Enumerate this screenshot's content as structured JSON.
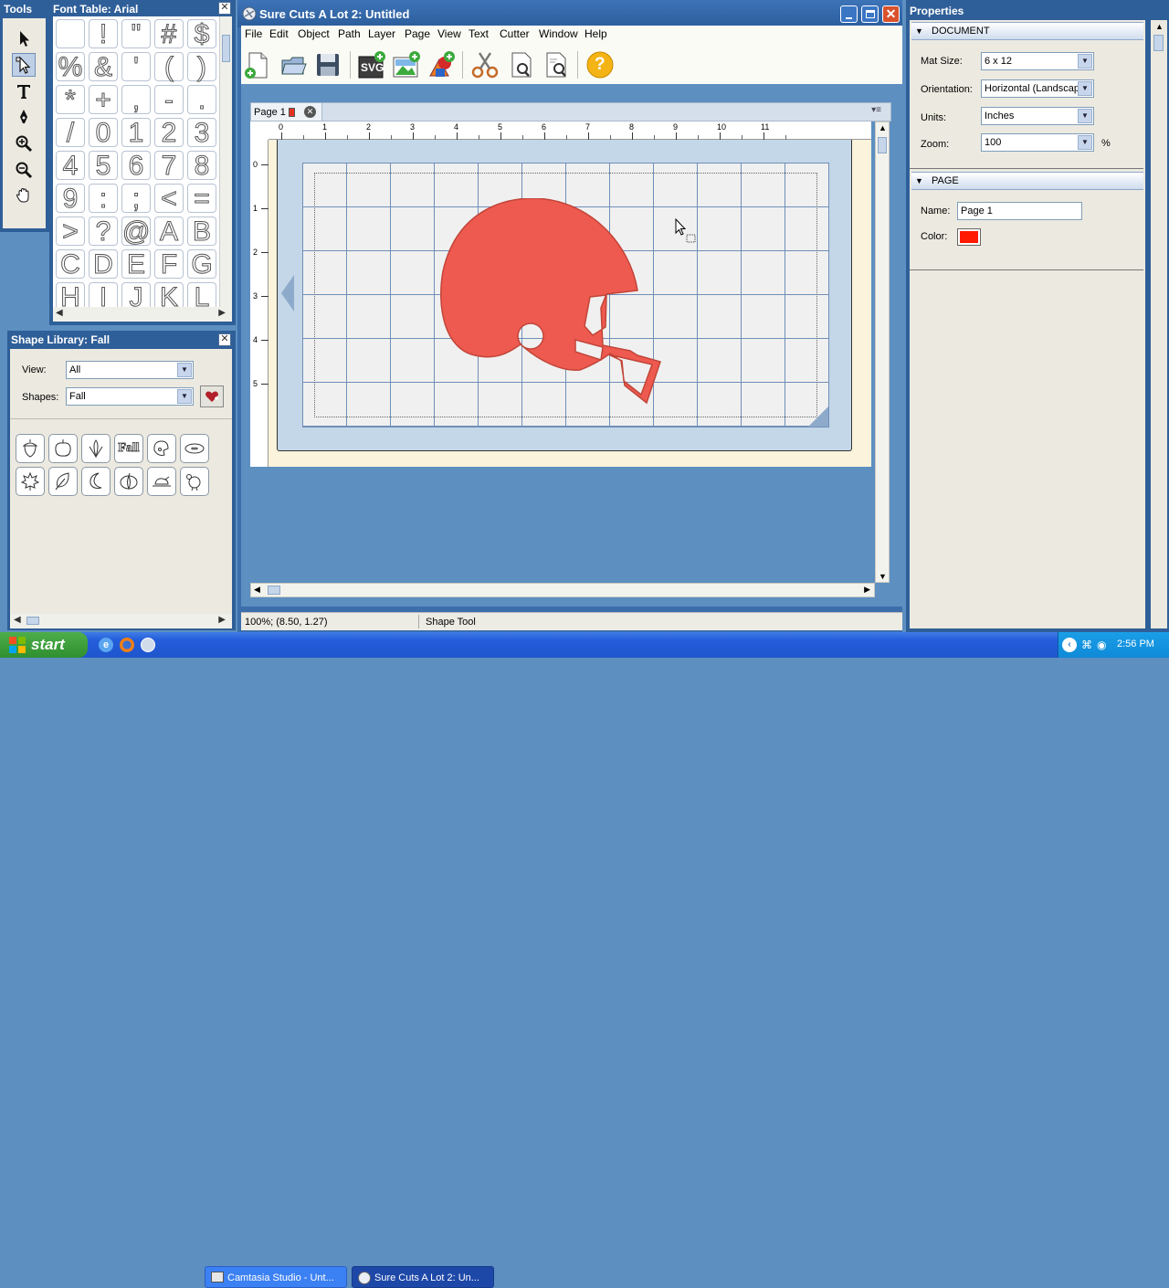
{
  "tools_panel": {
    "title": "Tools"
  },
  "font_table": {
    "title": "Font Table: Arial",
    "glyphs": [
      "",
      "!",
      "\"",
      "#",
      "$",
      "%",
      "&",
      "'",
      "(",
      ")",
      "*",
      "+",
      ",",
      "-",
      ".",
      "/",
      "0",
      "1",
      "2",
      "3",
      "4",
      "5",
      "6",
      "7",
      "8",
      "9",
      ":",
      ";",
      "<",
      "=",
      ">",
      "?",
      "@",
      "A",
      "B",
      "C",
      "D",
      "E",
      "F",
      "G",
      "H",
      "I",
      "J",
      "K",
      "L"
    ]
  },
  "shape_library": {
    "title": "Shape Library: Fall",
    "view_label": "View:",
    "view_value": "All",
    "shapes_label": "Shapes:",
    "shapes_value": "Fall",
    "thumb_text": "Fall"
  },
  "app": {
    "title": "Sure Cuts A Lot 2: Untitled",
    "menu": [
      "File",
      "Edit",
      "Object",
      "Path",
      "Layer",
      "Page",
      "View",
      "Text",
      "Cutter",
      "Window",
      "Help"
    ],
    "tab_label": "Page 1",
    "ruler_x": [
      "0",
      "1",
      "2",
      "3",
      "4",
      "5",
      "6",
      "7",
      "8",
      "9",
      "10",
      "11"
    ],
    "ruler_y": [
      "0",
      "1",
      "2",
      "3",
      "4",
      "5"
    ],
    "status_zoom": "100%; (8.50, 1.27)",
    "status_tool": "Shape Tool",
    "helmet_color": "#ee5a50",
    "svg_badge": "SVG",
    "help_glyph": "?"
  },
  "properties": {
    "title": "Properties",
    "document_header": "DOCUMENT",
    "mat_size_label": "Mat Size:",
    "mat_size_value": "6 x 12",
    "orientation_label": "Orientation:",
    "orientation_value": "Horizontal (Landscap",
    "units_label": "Units:",
    "units_value": "Inches",
    "zoom_label": "Zoom:",
    "zoom_value": "100",
    "zoom_unit": "%",
    "page_header": "PAGE",
    "name_label": "Name:",
    "name_value": "Page 1",
    "color_label": "Color:",
    "page_color": "#ff1a00"
  },
  "taskbar": {
    "start": "start",
    "task1": "Camtasia Studio - Unt...",
    "task2": "Sure Cuts A Lot 2: Un...",
    "clock": "2:56 PM"
  }
}
